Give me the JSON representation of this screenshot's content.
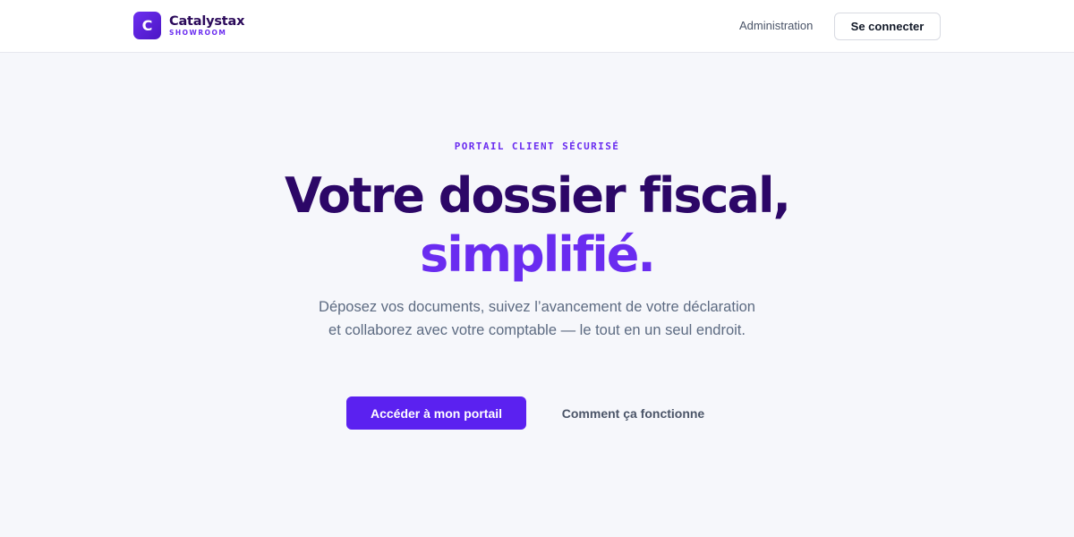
{
  "header": {
    "logo_letter": "C",
    "brand_name": "Catalystax",
    "brand_sub": "SHOWROOM",
    "nav_admin": "Administration",
    "login_button": "Se connecter"
  },
  "hero": {
    "eyebrow": "PORTAIL CLIENT SÉCURISÉ",
    "headline_line1": "Votre dossier fiscal,",
    "headline_line2": "simplifié.",
    "lead": "Déposez vos documents, suivez l’avancement de votre déclaration et collaborez avec votre comptable — le tout en un seul endroit.",
    "primary_button": "Accéder à mon portail",
    "secondary_button": "Comment ça fonctionne"
  },
  "colors": {
    "accent": "#6a2cf0",
    "primary_button": "#5b21f0",
    "headline_dark": "#2c0767",
    "background": "#f6f7fb"
  }
}
